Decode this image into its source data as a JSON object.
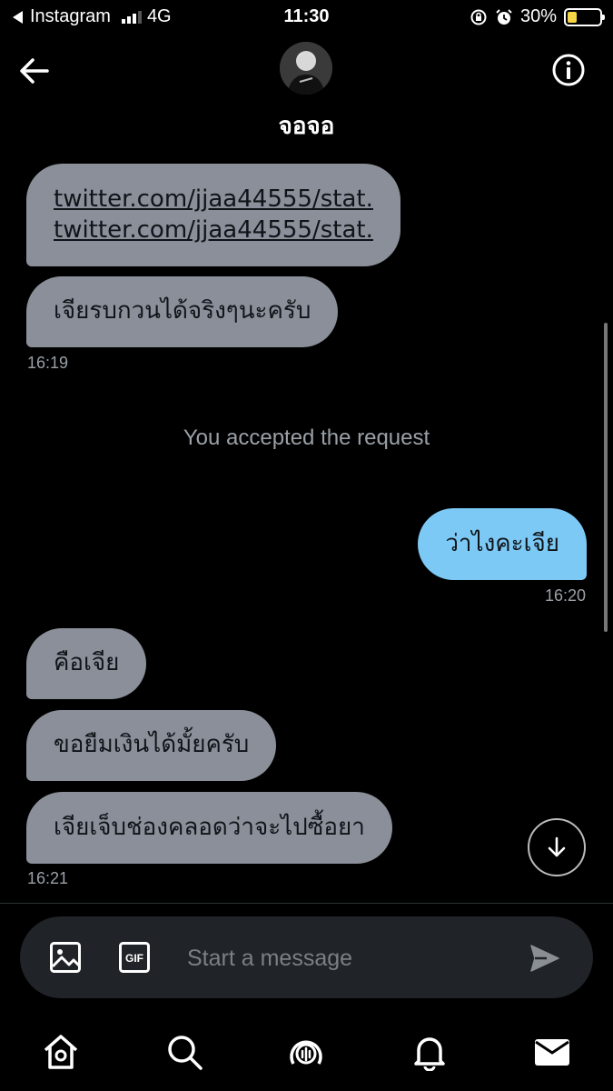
{
  "status_bar": {
    "carrier": "Instagram",
    "network": "4G",
    "time": "11:30",
    "battery": "30%",
    "battery_color": "#f5d547"
  },
  "header": {
    "contact_name": "จอจอ",
    "back_icon": "arrow-left-icon",
    "info_icon": "info-icon"
  },
  "messages": [
    {
      "direction": "incoming",
      "lines": [
        "twitter.com/jjaa44555/stat...",
        "twitter.com/jjaa44555/stat..."
      ]
    },
    {
      "direction": "incoming",
      "text": "เจียรบกวนได้จริงๆนะครับ",
      "time": "16:19"
    },
    {
      "direction": "outgoing",
      "text": "ว่าไงคะเจีย",
      "time": "16:20"
    },
    {
      "direction": "incoming",
      "text": "คือเจีย"
    },
    {
      "direction": "incoming",
      "text": "ขอยืมเงินได้มั้ยครับ"
    },
    {
      "direction": "incoming",
      "text": "เจียเจ็บช่องคลอดว่าจะไปซื้อยา",
      "time": "16:21"
    }
  ],
  "system_message": "You accepted the request",
  "composer": {
    "placeholder": "Start a message",
    "image_icon": "image-icon",
    "gif_label": "GIF",
    "send_icon": "send-icon"
  },
  "tab_bar": [
    "home-icon",
    "search-icon",
    "spaces-icon",
    "notifications-icon",
    "messages-icon"
  ],
  "colors": {
    "incoming_bubble": "#8b8f99",
    "outgoing_bubble": "#7dc9f5",
    "background": "#000000"
  }
}
